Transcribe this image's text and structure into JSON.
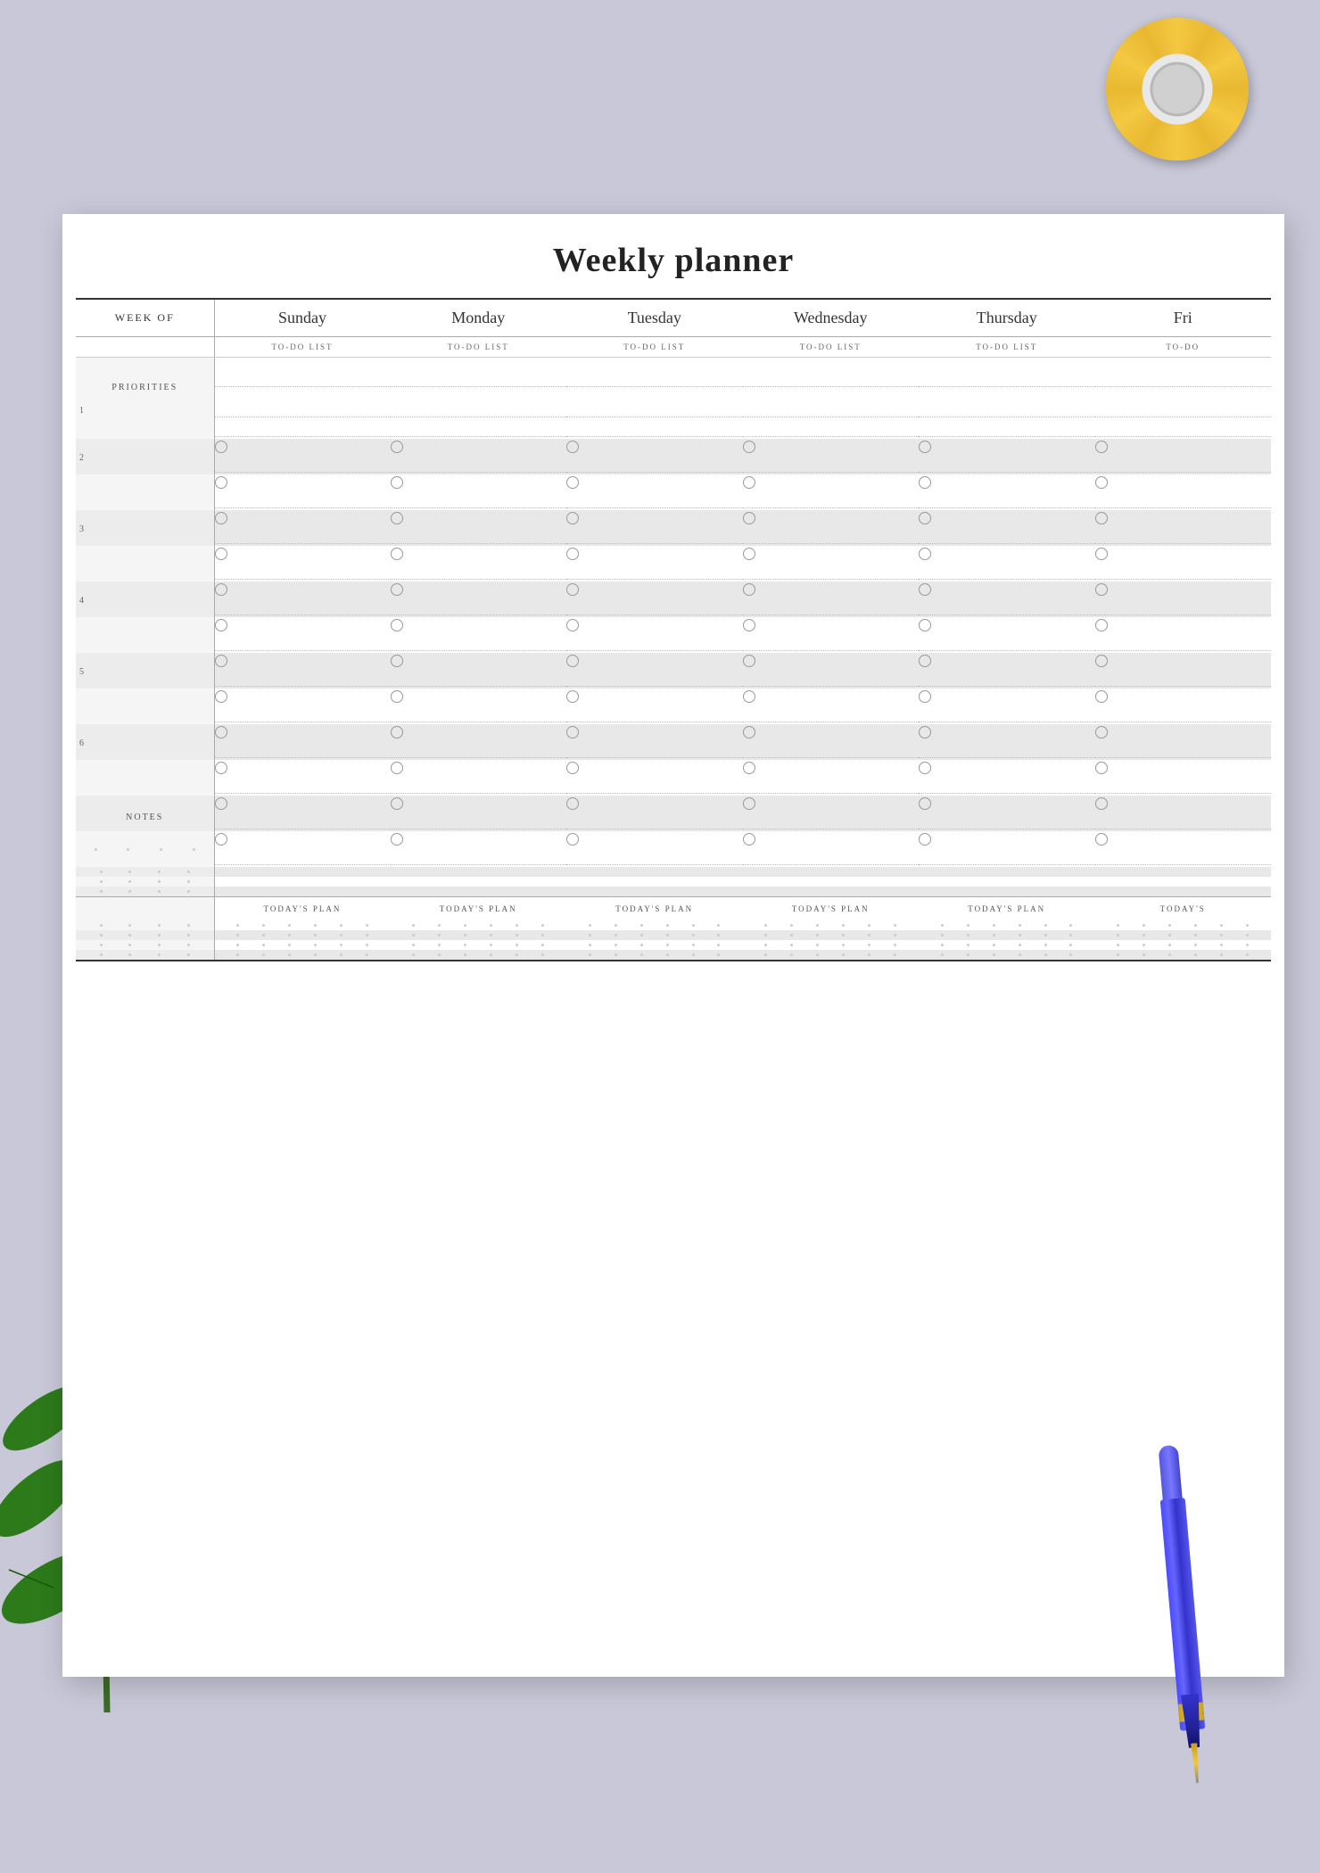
{
  "page": {
    "background_color": "#c8c8d8",
    "title": "Weekly planner"
  },
  "header": {
    "week_of_label": "WEEK OF",
    "days": [
      "Sunday",
      "Monday",
      "Tuesday",
      "Wednesday",
      "Thursday",
      "Fri"
    ],
    "todo_label": "TO-DO LIST"
  },
  "left_column": {
    "priorities_label": "PRIORITIES",
    "priority_numbers": [
      "1",
      "2",
      "3",
      "4",
      "5",
      "6"
    ],
    "notes_label": "NOTES"
  },
  "sections": {
    "todays_plan_label": "TODAY'S PLAN"
  }
}
